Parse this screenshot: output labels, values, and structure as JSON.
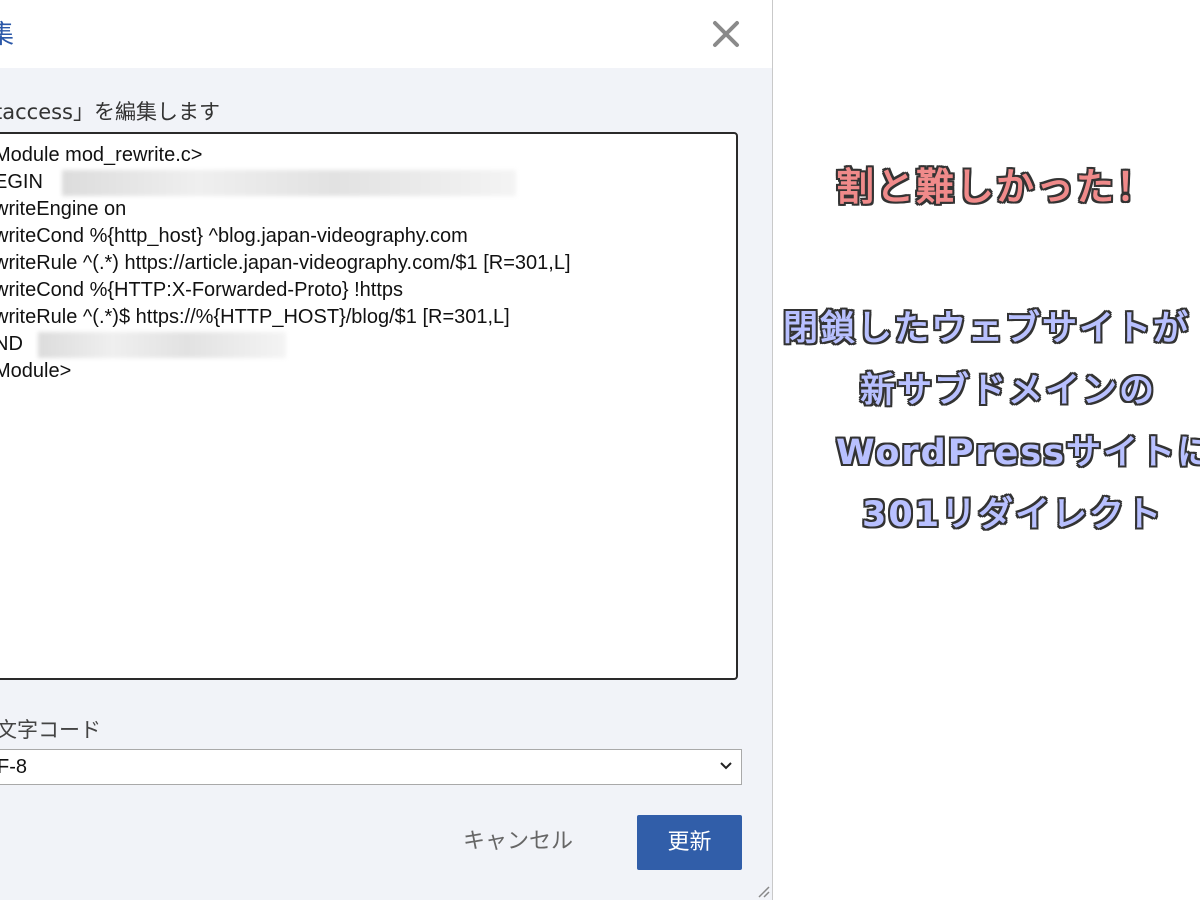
{
  "dialog": {
    "title": "集",
    "instruction": "taccess」を編集します",
    "code_lines": [
      "Module mod_rewrite.c>",
      "EGIN",
      "writeEngine on",
      "writeCond %{http_host} ^blog.japan-videography.com",
      "writeRule ^(.*) https://article.japan-videography.com/$1 [R=301,L]",
      "writeCond %{HTTP:X-Forwarded-Proto} !https",
      "writeRule ^(.*)$ https://%{HTTP_HOST}/blog/$1 [R=301,L]",
      "ND",
      "Module>"
    ],
    "encoding_label": "文字コード",
    "encoding_value": "F-8",
    "cancel_label": "キャンセル",
    "update_label": "更新",
    "close_icon": "close-icon",
    "accent_color": "#315ea9"
  },
  "annotation": {
    "headline": "割と難しかった！",
    "lines": [
      "閉鎖したウェブサイトが",
      "新サブドメインの",
      "WordPressサイトに",
      "301リダイレクト"
    ],
    "headline_color": "#f08a8a",
    "lines_color": "#b8c0ff"
  }
}
